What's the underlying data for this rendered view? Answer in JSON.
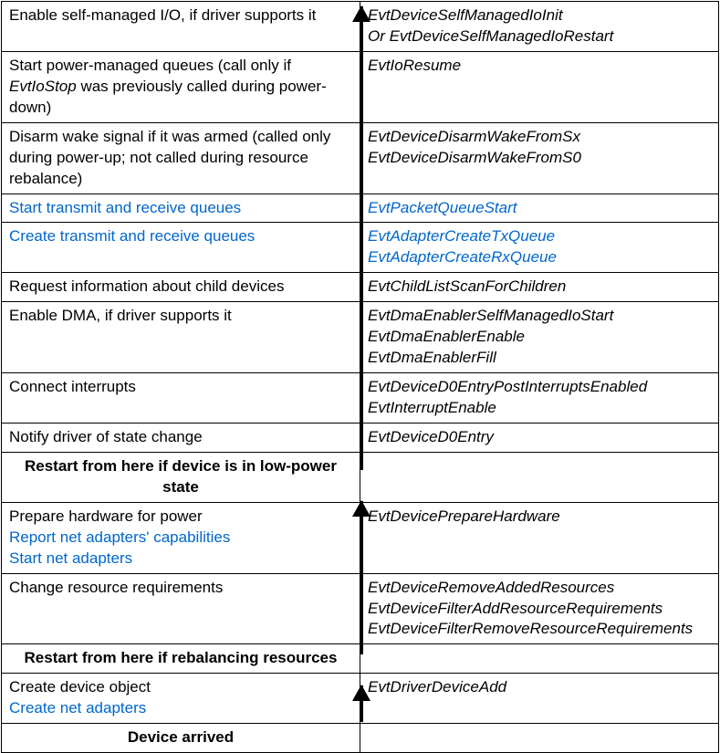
{
  "rows": [
    {
      "left": [
        {
          "text": "Enable self-managed I/O, if driver supports it"
        }
      ],
      "right": [
        {
          "text": "EvtDeviceSelfManagedIoInit"
        },
        {
          "text": "Or EvtDeviceSelfManagedIoRestart"
        }
      ]
    },
    {
      "left": [
        {
          "text": "Start power-managed queues (call only if "
        },
        {
          "text": "EvtIoStop",
          "ital": true
        },
        {
          "text": " was previously called during power-down)"
        }
      ],
      "right": [
        {
          "text": "EvtIoResume"
        }
      ]
    },
    {
      "left": [
        {
          "text": "Disarm wake signal if it was armed (called only during power-up; not called during resource rebalance)"
        }
      ],
      "right": [
        {
          "text": "EvtDeviceDisarmWakeFromSx"
        },
        {
          "text": "EvtDeviceDisarmWakeFromS0"
        }
      ]
    },
    {
      "left": [
        {
          "text": "Start transmit and receive queues",
          "link": true
        }
      ],
      "right": [
        {
          "text": "EvtPacketQueueStart",
          "link": true
        }
      ]
    },
    {
      "left": [
        {
          "text": "Create transmit and receive queues",
          "link": true
        }
      ],
      "right": [
        {
          "text": "EvtAdapterCreateTxQueue",
          "link": true
        },
        {
          "text": "EvtAdapterCreateRxQueue",
          "link": true
        }
      ]
    },
    {
      "left": [
        {
          "text": "Request information about child devices"
        }
      ],
      "right": [
        {
          "text": "EvtChildListScanForChildren"
        }
      ]
    },
    {
      "left": [
        {
          "text": "Enable DMA, if driver supports it"
        }
      ],
      "right": [
        {
          "text": "EvtDmaEnablerSelfManagedIoStart"
        },
        {
          "text": "EvtDmaEnablerEnable"
        },
        {
          "text": "EvtDmaEnablerFill"
        }
      ]
    },
    {
      "left": [
        {
          "text": "Connect interrupts"
        }
      ],
      "right": [
        {
          "text": "EvtDeviceD0EntryPostInterruptsEnabled"
        },
        {
          "text": "EvtInterruptEnable"
        }
      ]
    },
    {
      "left": [
        {
          "text": "Notify driver of state change"
        }
      ],
      "right": [
        {
          "text": "EvtDeviceD0Entry"
        }
      ]
    }
  ],
  "full1": "Restart from here if device is in low-power state",
  "rows2": [
    {
      "left": [
        {
          "text": "Prepare hardware for power",
          "block": true
        },
        {
          "text": "Report net adapters' capabilities",
          "link": true,
          "block": true
        },
        {
          "text": "Start net adapters",
          "link": true,
          "block": true
        }
      ],
      "right": [
        {
          "text": "EvtDevicePrepareHardware"
        }
      ]
    },
    {
      "left": [
        {
          "text": "Change resource requirements"
        }
      ],
      "right": [
        {
          "text": "EvtDeviceRemoveAddedResources"
        },
        {
          "text": "EvtDeviceFilterAddResourceRequirements"
        },
        {
          "text": "EvtDeviceFilterRemoveResourceRequirements"
        }
      ]
    }
  ],
  "full2": "Restart from here if rebalancing resources",
  "rows3": [
    {
      "left": [
        {
          "text": "Create device object",
          "block": true
        },
        {
          "text": "Create net adapters",
          "link": true,
          "block": true
        }
      ],
      "right": [
        {
          "text": "EvtDriverDeviceAdd"
        }
      ]
    }
  ],
  "full3": "Device arrived"
}
